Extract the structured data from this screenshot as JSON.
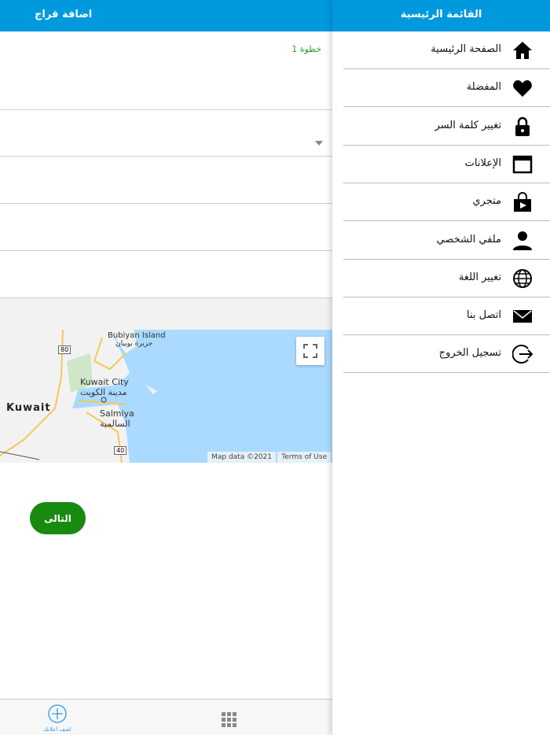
{
  "form": {
    "title": "اضافة قراج",
    "step": "خطوة 1",
    "next_label": "التالى"
  },
  "map": {
    "labels": {
      "island_en": "Bubiyan Island",
      "island_ar": "جزيرة بوبيان",
      "city_en": "Kuwait City",
      "city_ar": "مدينة الكويت",
      "salmiya_en": "Salmiya",
      "salmiya_ar": "السالمية",
      "country": "Kuwait",
      "road80": "80",
      "road40": "40"
    },
    "attribution": "Map data ©2021",
    "terms": "Terms of Use"
  },
  "bottom_nav": {
    "add_label": "اضف اعلانك"
  },
  "drawer": {
    "title": "القائمة الرئيسية",
    "items": [
      {
        "label": "الصفحة الرئيسية",
        "icon": "home-icon"
      },
      {
        "label": "المفضلة",
        "icon": "heart-icon"
      },
      {
        "label": "تغيير كلمة السر",
        "icon": "lock-icon"
      },
      {
        "label": "الإعلانات",
        "icon": "window-icon"
      },
      {
        "label": "متجري",
        "icon": "store-bag-icon"
      },
      {
        "label": "ملفي الشخصي",
        "icon": "person-icon"
      },
      {
        "label": "تغيير اللغة",
        "icon": "globe-icon"
      },
      {
        "label": "اتصل بنا",
        "icon": "envelope-icon"
      },
      {
        "label": "تسجيل الخروج",
        "icon": "logout-icon"
      }
    ]
  },
  "colors": {
    "primary": "#0099dd",
    "step_green": "#2a9a2a",
    "button_green": "#188a10"
  }
}
